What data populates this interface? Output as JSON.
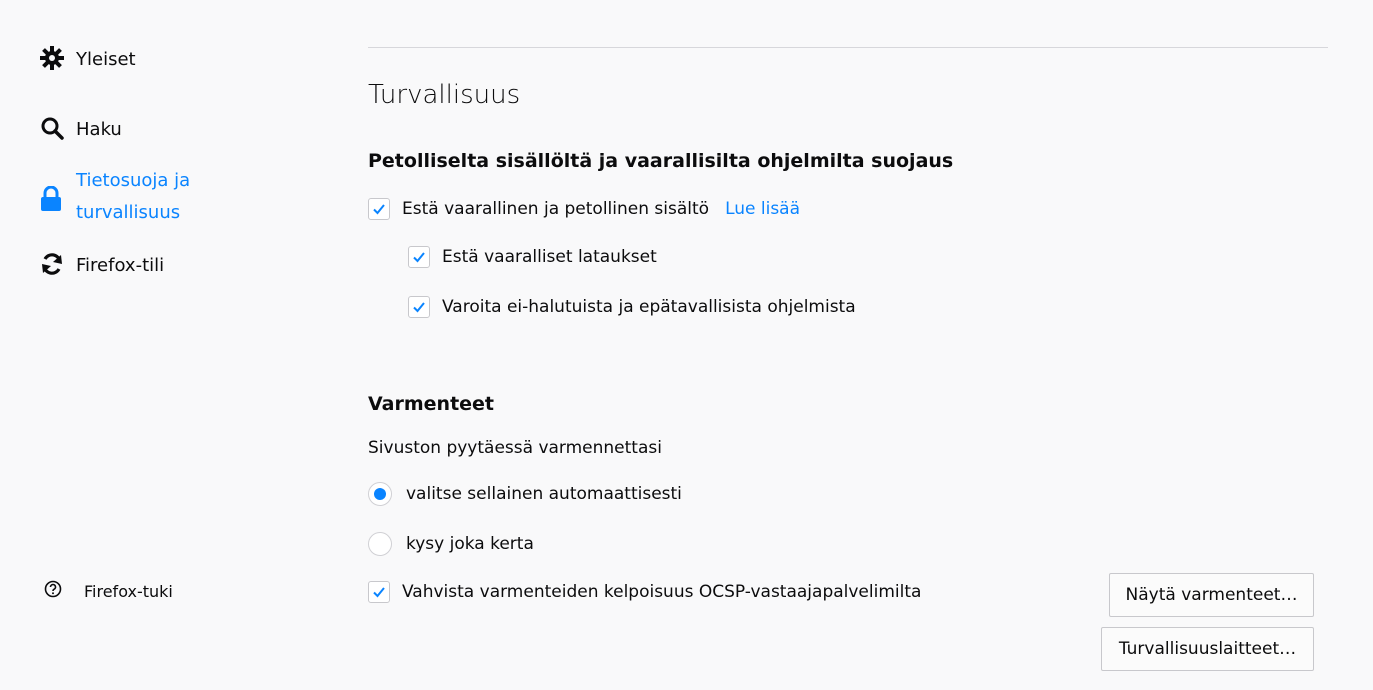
{
  "sidebar": {
    "items": [
      {
        "label": "Yleiset",
        "icon": "gear-icon"
      },
      {
        "label": "Haku",
        "icon": "search-icon"
      },
      {
        "label": "Tietosuoja ja turvallisuus",
        "icon": "lock-icon",
        "selected": true
      },
      {
        "label": "Firefox-tili",
        "icon": "sync-icon"
      }
    ],
    "support": {
      "label": "Firefox-tuki",
      "icon": "help-icon"
    }
  },
  "main": {
    "title": "Turvallisuus",
    "protection": {
      "heading": "Petolliselta sisällöltä ja vaarallisilta ohjelmilta suojaus",
      "block_dangerous": {
        "label": "Estä vaarallinen ja petollinen sisältö",
        "checked": true
      },
      "learn_more": "Lue lisää",
      "block_downloads": {
        "label": "Estä vaaralliset lataukset",
        "checked": true
      },
      "warn_unwanted": {
        "label": "Varoita ei-halutuista ja epätavallisista ohjelmista",
        "checked": true
      }
    },
    "certificates": {
      "heading": "Varmenteet",
      "prompt": "Sivuston pyytäessä varmennettasi",
      "auto_select": {
        "label": "valitse sellainen automaattisesti",
        "selected": true
      },
      "ask_every_time": {
        "label": "kysy joka kerta",
        "selected": false
      },
      "ocsp": {
        "label": "Vahvista varmenteiden kelpoisuus OCSP-vastaajapalvelimilta",
        "checked": true
      },
      "view_button": "Näytä varmenteet…",
      "devices_button": "Turvallisuuslaitteet…"
    }
  },
  "colors": {
    "accent": "#0a84ff",
    "background": "#f9f9fa",
    "text": "#0c0c0d"
  }
}
